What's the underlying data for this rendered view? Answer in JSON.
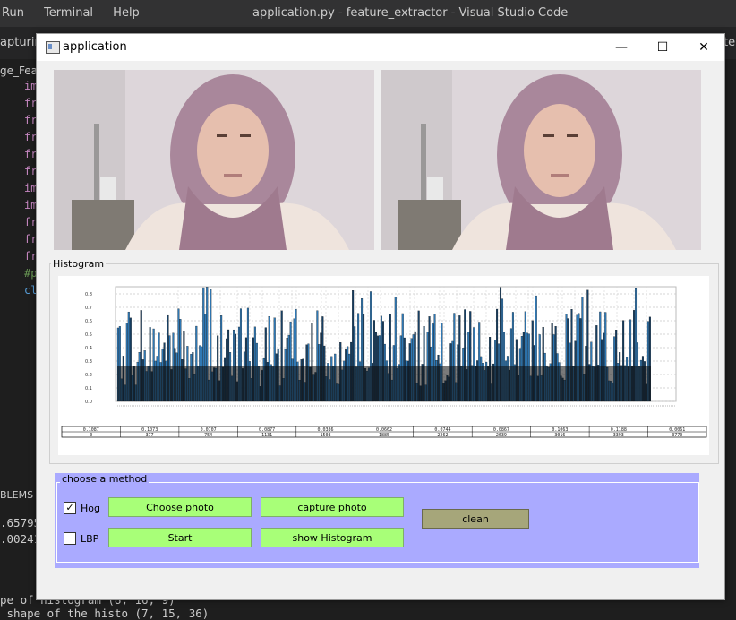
{
  "vscode": {
    "menu": [
      "Run",
      "Terminal",
      "Help"
    ],
    "title": "application.py - feature_extractor - Visual Studio Code",
    "tab_left": "apturin",
    "tab_right": "te.",
    "breadcrumb": "ge_Feat",
    "code_prefixes": [
      "im",
      "fr",
      "fr",
      "fr",
      "fr",
      "fr",
      "im",
      "im",
      "fr",
      "fr",
      "fr",
      "#p",
      "cl"
    ],
    "panel_label": "BLEMS",
    "panel_values": [
      ".65795",
      ".00241"
    ],
    "terminal_lines": [
      "pe of histogram (8, 16, 9)",
      " shape of the histo (7, 15, 36)"
    ]
  },
  "window": {
    "title": "application",
    "controls": {
      "minimize": "—",
      "maximize": "☐",
      "close": "✕"
    }
  },
  "histogram": {
    "group_title": "Histogram",
    "chart_data": {
      "type": "bar",
      "y_ticks": [
        "0.8",
        "0.7",
        "0.6",
        "0.5",
        "0.4",
        "0.3",
        "0.2",
        "0.1",
        "0.0"
      ],
      "ylim": [
        0,
        0.85
      ],
      "table_top": [
        "0.1087",
        "0.1073",
        "0.0707",
        "0.0877",
        "0.0386",
        "0.0662",
        "0.0744",
        "0.0867",
        "0.1063",
        "0.1188",
        "0.0061"
      ],
      "table_bottom": [
        "0",
        "377",
        "754",
        "1131",
        "1508",
        "1885",
        "2262",
        "2639",
        "3016",
        "3393",
        "3770"
      ]
    }
  },
  "method": {
    "group_title": "choose a method",
    "hog_label": "Hog",
    "lbp_label": "LBP",
    "hog_checked": true,
    "lbp_checked": false,
    "choose_photo": "Choose photo",
    "capture_photo": "capture photo",
    "start": "Start",
    "show_histogram": "show Histogram",
    "clean": "clean"
  }
}
